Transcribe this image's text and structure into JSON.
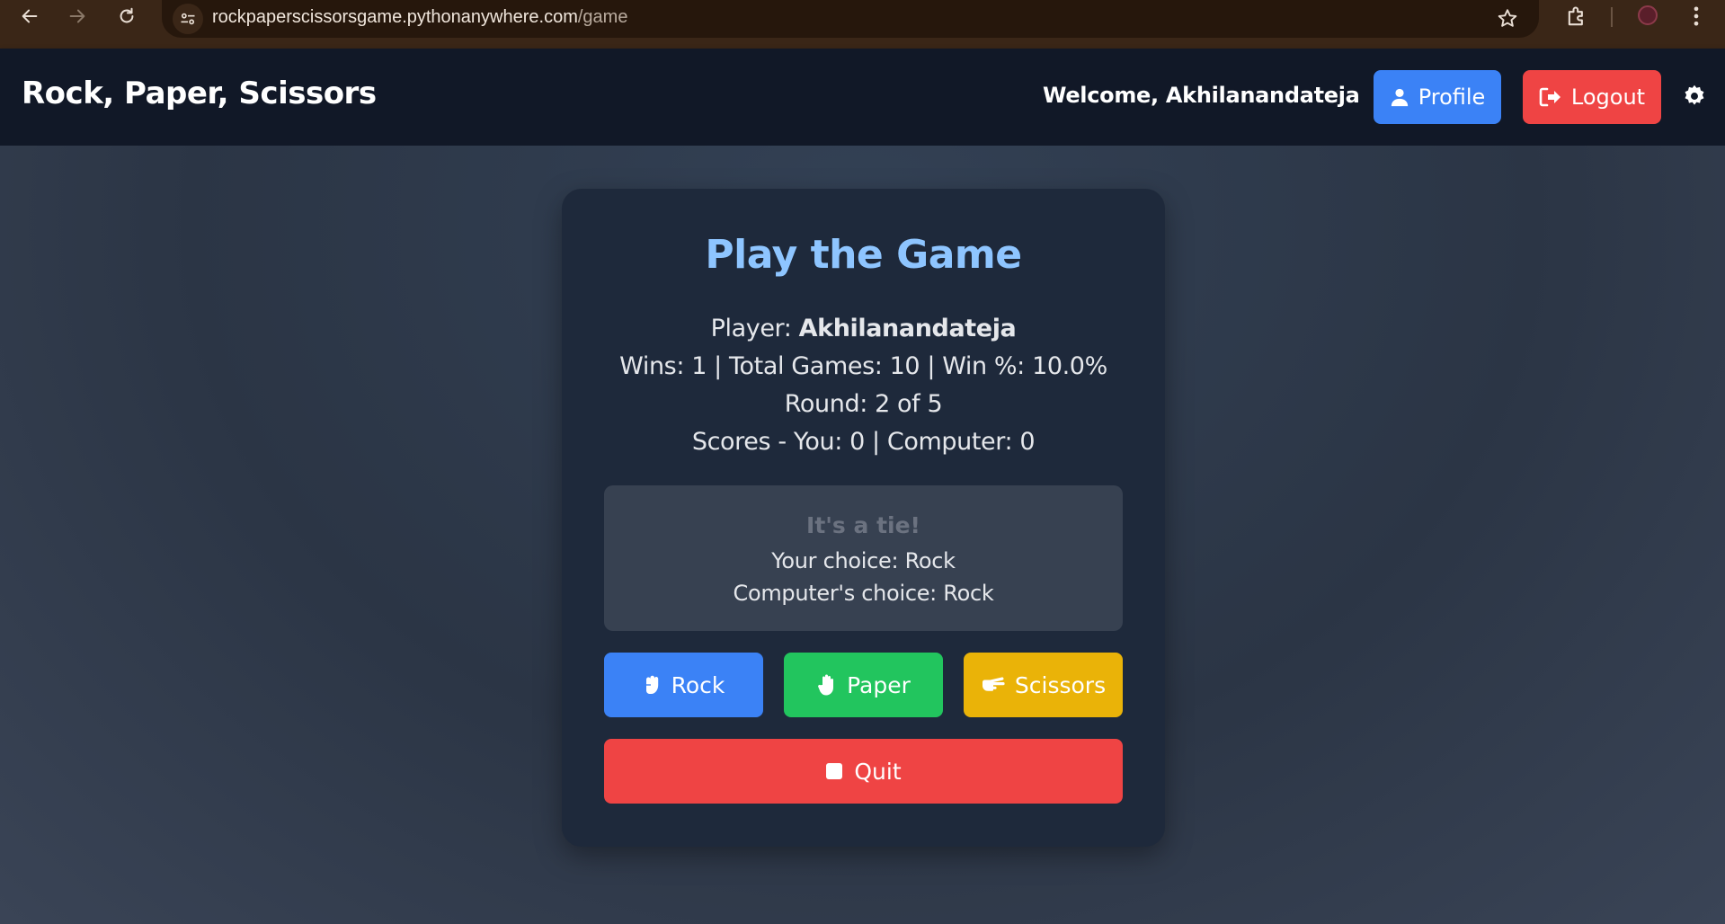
{
  "browser": {
    "url_host": "rockpaperscissorsgame.pythonanywhere.com",
    "url_path": "/game"
  },
  "header": {
    "brand": "Rock, Paper, Scissors",
    "welcome": "Welcome, Akhilanandateja",
    "profile_label": "Profile",
    "logout_label": "Logout"
  },
  "game": {
    "title": "Play the Game",
    "player_prefix": "Player: ",
    "player_name": "Akhilanandateja",
    "stats": "Wins: 1 | Total Games: 10 | Win %: 10.0%",
    "round": "Round: 2 of 5",
    "scores": "Scores - You: 0 | Computer: 0",
    "result": {
      "headline": "It's a tie!",
      "your_choice": "Your choice: Rock",
      "computer_choice": "Computer's choice: Rock"
    },
    "choices": {
      "rock": "Rock",
      "paper": "Paper",
      "scissors": "Scissors"
    },
    "quit_label": "Quit"
  },
  "colors": {
    "accent_blue": "#3b82f6",
    "accent_green": "#22c55e",
    "accent_yellow": "#eab308",
    "accent_red": "#ef4444",
    "title_blue": "#8ec5ff"
  },
  "icons": {
    "back": "back-arrow-icon",
    "forward": "forward-arrow-icon",
    "reload": "reload-icon",
    "site_info": "site-info-icon",
    "bookmark": "star-icon",
    "extensions": "puzzle-icon",
    "menu": "kebab-menu-icon",
    "profile": "user-icon",
    "logout": "sign-out-icon",
    "theme": "gear-icon",
    "rock": "fist-icon",
    "paper": "hand-icon",
    "scissors": "scissors-hand-icon",
    "quit": "stop-icon"
  }
}
